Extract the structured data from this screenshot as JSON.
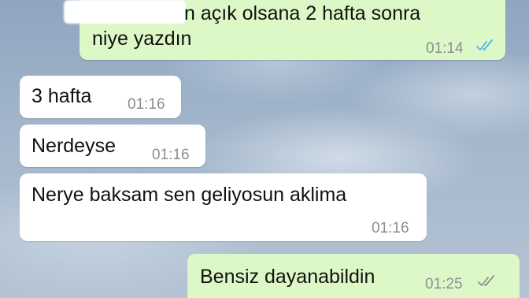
{
  "colors": {
    "outgoing_bubble": "#dcf8c6",
    "incoming_bubble": "#ffffff",
    "read_tick": "#4fb3f0",
    "delivered_tick": "#8a8f94",
    "timestamp": "#8a8f94"
  },
  "messages": [
    {
      "direction": "outgoing",
      "line1": "n açık olsana 2 hafta sonra",
      "line2": "niye yazdın",
      "time": "01:14",
      "status_icon": "double-check-read-icon"
    },
    {
      "direction": "incoming",
      "text": "3 hafta",
      "time": "01:16"
    },
    {
      "direction": "incoming",
      "text": "Nerdeyse",
      "time": "01:16"
    },
    {
      "direction": "incoming",
      "text": "Nerye baksam sen geliyosun aklima",
      "time": "01:16"
    },
    {
      "direction": "outgoing",
      "text": "Bensiz dayanabildin",
      "time": "01:25",
      "status_icon": "double-check-delivered-icon"
    }
  ]
}
